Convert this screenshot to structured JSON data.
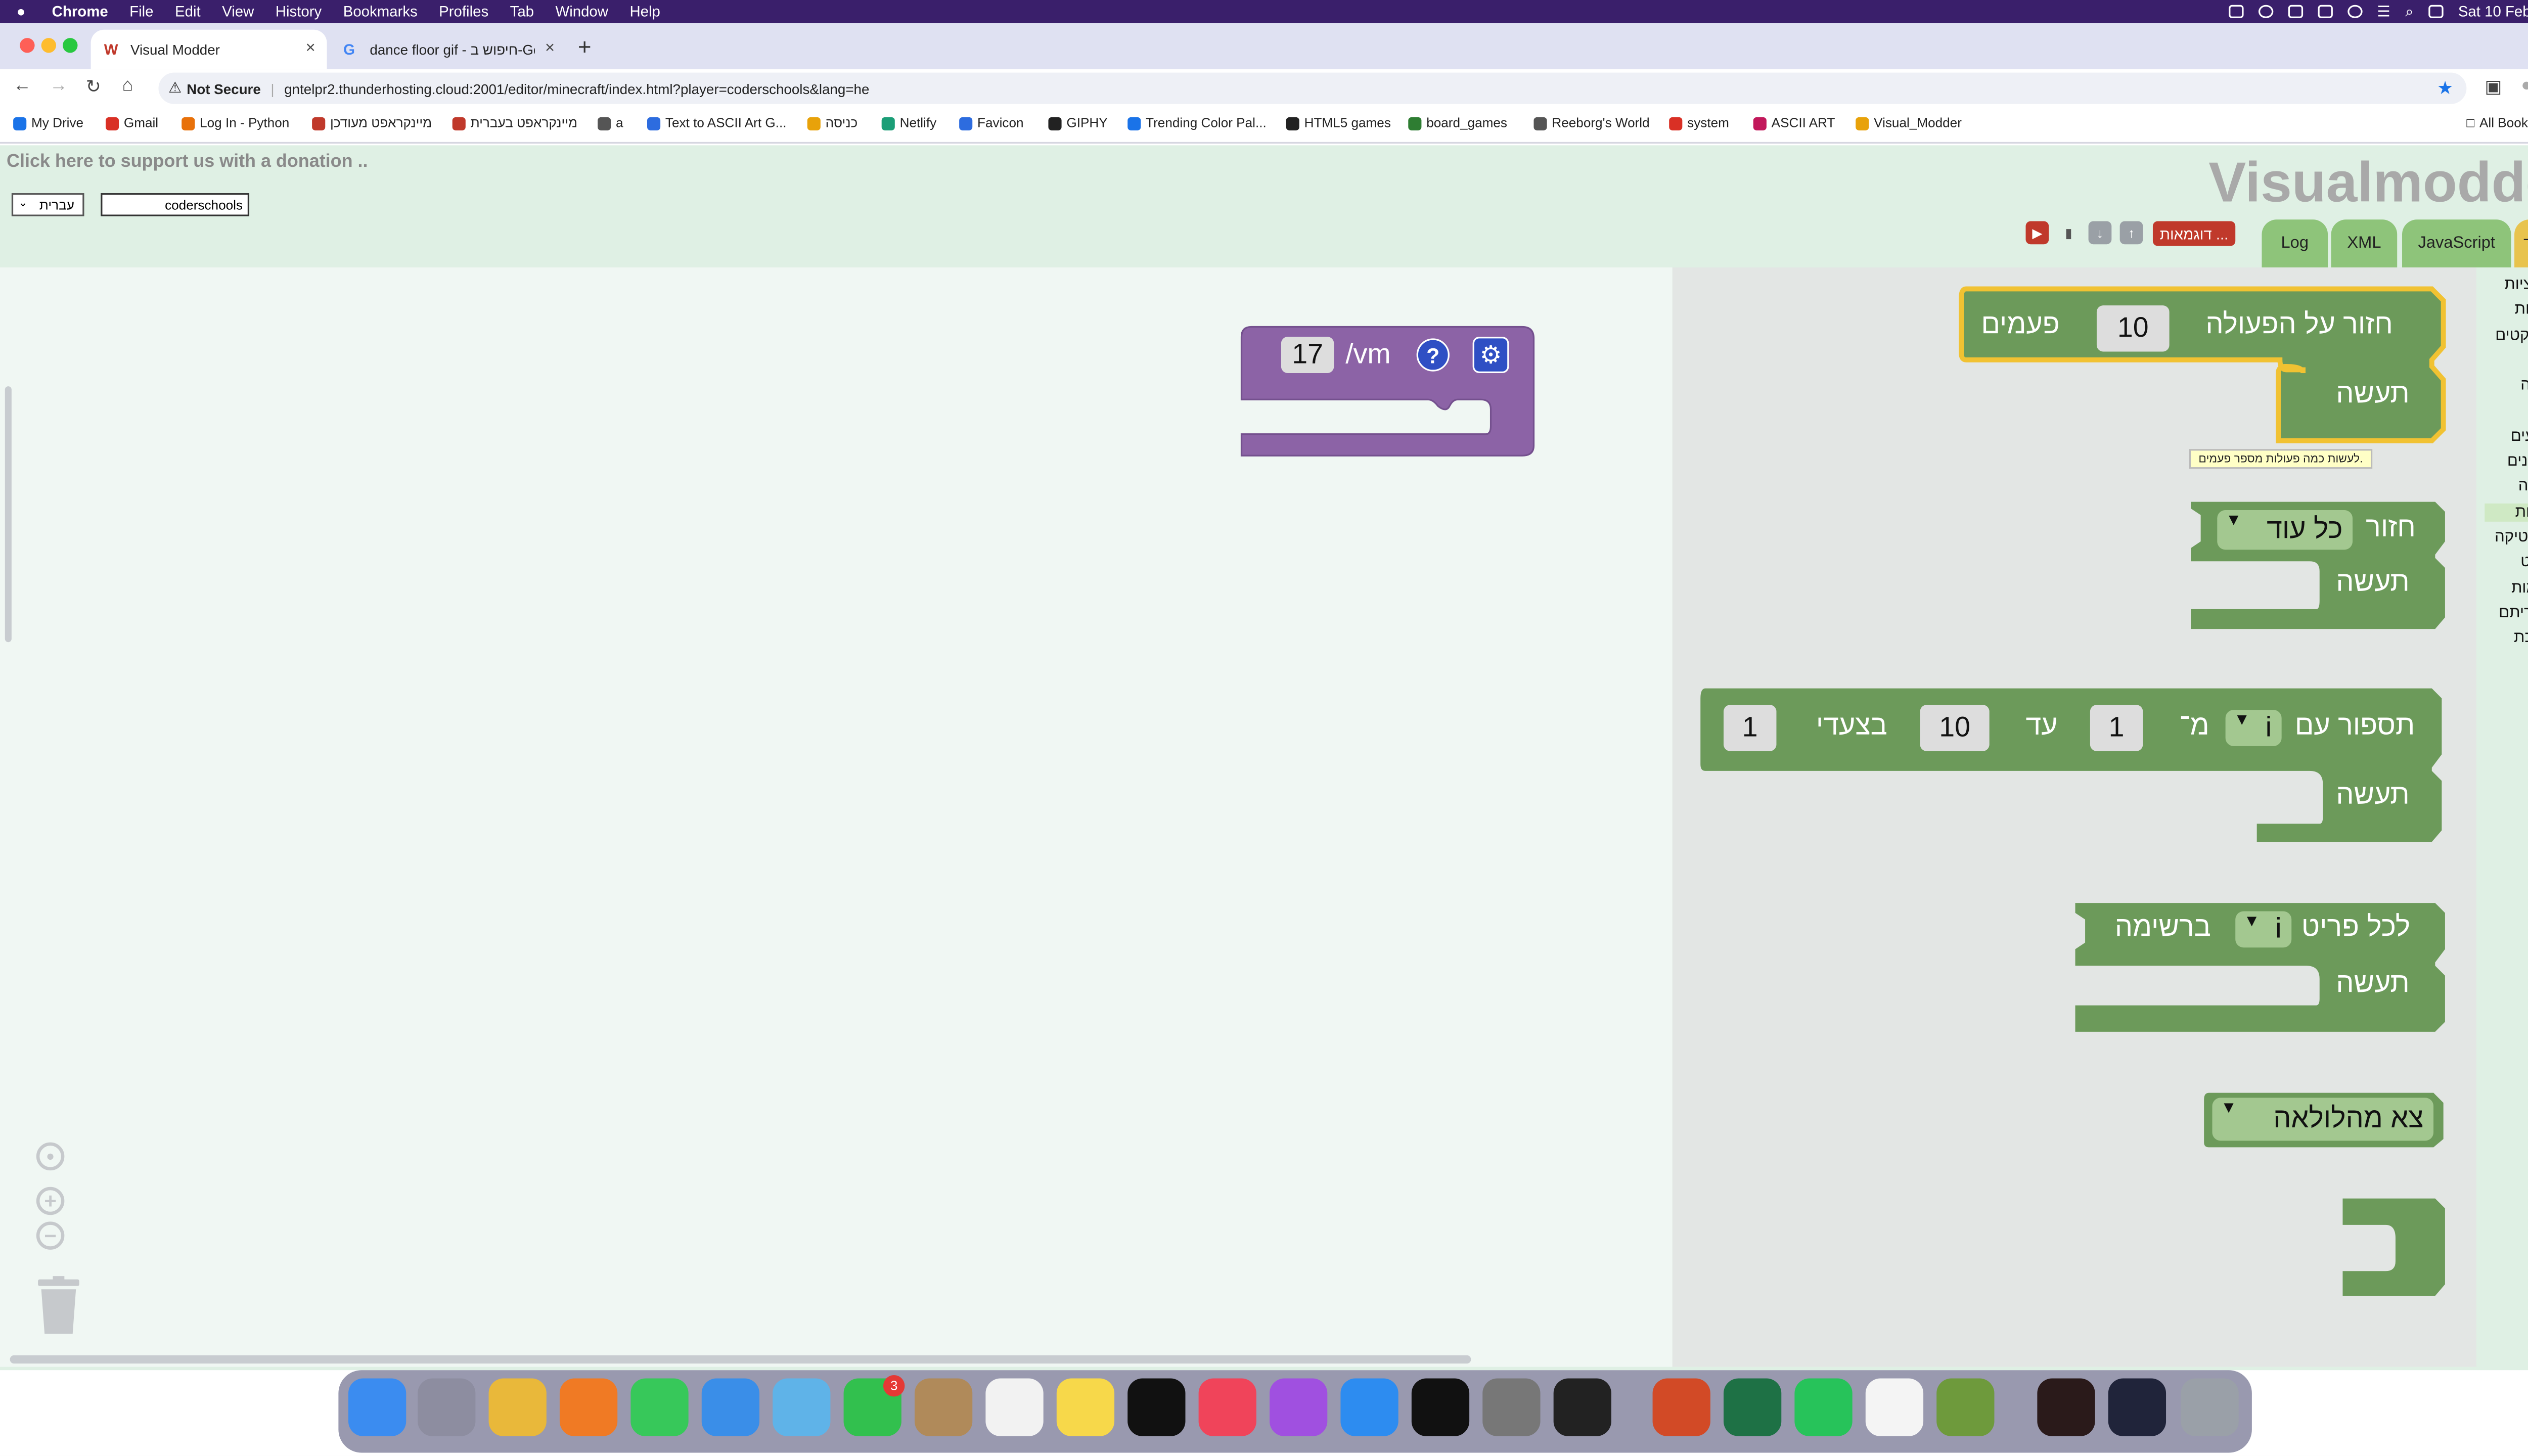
{
  "menubar": {
    "app": "Chrome",
    "items": [
      "File",
      "Edit",
      "View",
      "History",
      "Bookmarks",
      "Profiles",
      "Tab",
      "Window",
      "Help"
    ],
    "clock": "Sat 10 Feb  10:36"
  },
  "tabs": [
    {
      "label": "Visual Modder",
      "favicon": "W"
    },
    {
      "label": "dance floor gif - חיפוש ב-Goo",
      "favicon": "G"
    }
  ],
  "address": {
    "security": "Not Secure",
    "url": "gntelpr2.thunderhosting.cloud:2001/editor/minecraft/index.html?player=coderschools&lang=he"
  },
  "bookmarks": [
    "My Drive",
    "Gmail",
    "Log In - Python",
    "מיינקראפט מעודכן",
    "מיינקראפט בעברית",
    "a",
    "Text to ASCII Art G...",
    "כניסה",
    "Netlify",
    "Favicon",
    "GIPHY",
    "Trending Color Pal...",
    "HTML5 games",
    "board_games",
    "Reeborg's World",
    "system",
    "ASCII ART",
    "Visual_Modder"
  ],
  "all_bookmarks": "All Bookmarks",
  "page": {
    "donation": "Click here to support us with a donation ..",
    "language": "עברית",
    "player": "coderschools",
    "logo": "Visualmodder",
    "examples_button": "דוגמאות ...",
    "tabs": [
      "Log",
      "XML",
      "JavaScript",
      "קטעי קוד"
    ]
  },
  "toolbox": {
    "categories": [
      {
        "label": "פונקציות",
        "color": "#8a6fa8"
      },
      {
        "label": "פעולות",
        "color": "#5b67a5"
      },
      {
        "label": "אובייקטים",
        "color": "#5b67a5"
      },
      {
        "label": "זמן",
        "color": "#5b67a5"
      },
      {
        "label": "תנועה",
        "color": "#5b67a5"
      },
      {
        "label": "ציור",
        "color": "#5b67a5"
      },
      {
        "label": "אירועים",
        "color": "#5b67a5"
      },
      {
        "label": "משתנים",
        "color": "#a55b80"
      },
      {
        "label": "לוגיקה",
        "color": "#5b80a5"
      },
      {
        "label": "לולאות",
        "color": "#5ba55b"
      },
      {
        "label": "מתמטיקה",
        "color": "#5b67a5"
      },
      {
        "label": "טקסט",
        "color": "#5ba58c"
      },
      {
        "label": "רשימות",
        "color": "#745ba5"
      },
      {
        "label": "אלגוריתם",
        "color": "#5b67a5"
      },
      {
        "label": "מערכת",
        "color": "#5b67a5"
      }
    ],
    "selected": "לולאות"
  },
  "flyout": {
    "repeat": {
      "label": "חזור על הפעולה",
      "times": "10",
      "suffix": "פעמים",
      "do": "תעשה"
    },
    "tooltip": "לעשות כמה פעולות מספר פעמים.",
    "while": {
      "label": "חזור",
      "mode": "כל עוד",
      "do": "תעשה"
    },
    "for": {
      "label": "תספור עם",
      "var": "i",
      "from_label": "מ־",
      "from": "1",
      "to_label": "עד",
      "to": "10",
      "by_label": "בצעדי",
      "by": "1",
      "do": "תעשה"
    },
    "foreach": {
      "label": "לכל פריט",
      "var": "i",
      "in_label": "ברשימה",
      "do": "תעשה"
    },
    "break": {
      "label": "צא מהלולאה"
    }
  },
  "workspace": {
    "command_block": {
      "prefix": "/vm",
      "value": "17",
      "help": "?"
    }
  },
  "dock": {
    "facetime_badge": "3"
  }
}
